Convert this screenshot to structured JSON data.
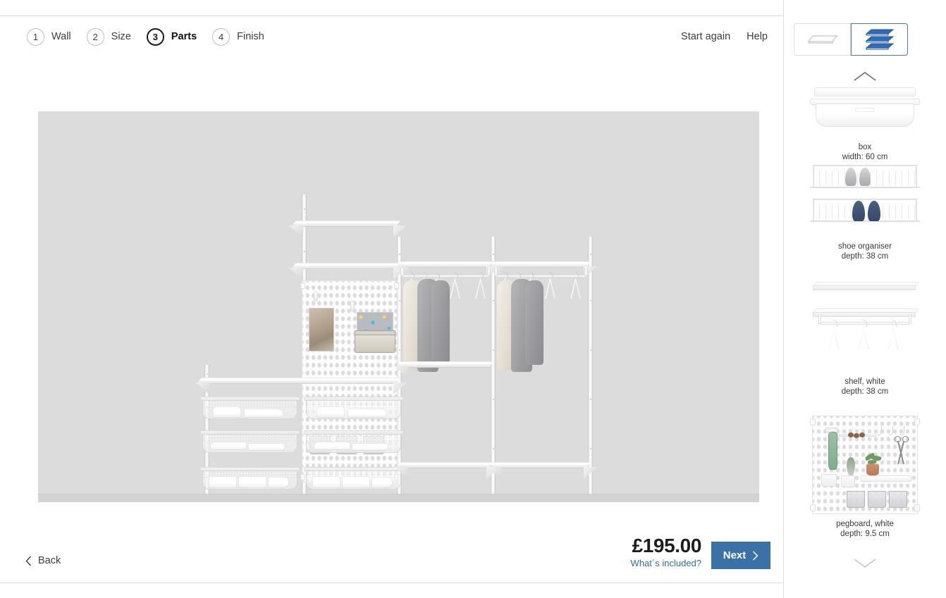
{
  "header": {
    "steps": [
      {
        "number": "1",
        "label": "Wall",
        "active": false
      },
      {
        "number": "2",
        "label": "Size",
        "active": false
      },
      {
        "number": "3",
        "label": "Parts",
        "active": true
      },
      {
        "number": "4",
        "label": "Finish",
        "active": false
      }
    ],
    "links": [
      {
        "label": "Start again",
        "name": "start-again-link"
      },
      {
        "label": "Help",
        "name": "help-link"
      }
    ]
  },
  "viewer": {
    "background_color": "#dcdcdd",
    "floor_color": "#d3d3d4",
    "description": "3D wardrobe configuration preview"
  },
  "footer": {
    "back_label": "Back",
    "price": "£195.00",
    "included_label": "What´s included?",
    "next_label": "Next",
    "link_color": "#2f6da4",
    "button_color": "#3a72a8"
  },
  "sidebar": {
    "view_toggle": {
      "options": [
        {
          "name": "single-shelf-view-icon",
          "active": false
        },
        {
          "name": "stacked-shelves-view-icon",
          "active": true
        }
      ],
      "active_color": "#4a7ba7"
    },
    "scroll_up": "scroll-up-chevron-icon",
    "scroll_down": "scroll-down-chevron-icon",
    "parts": [
      {
        "name": "box",
        "spec": "width: 60 cm",
        "art": "box"
      },
      {
        "name": "shoe organiser",
        "spec": "depth: 38 cm",
        "art": "shoe-organiser"
      },
      {
        "name": "shelf, white",
        "spec": "depth: 38 cm",
        "art": "shelf"
      },
      {
        "name": "pegboard, white",
        "spec": "depth: 9.5 cm",
        "art": "pegboard"
      }
    ]
  }
}
